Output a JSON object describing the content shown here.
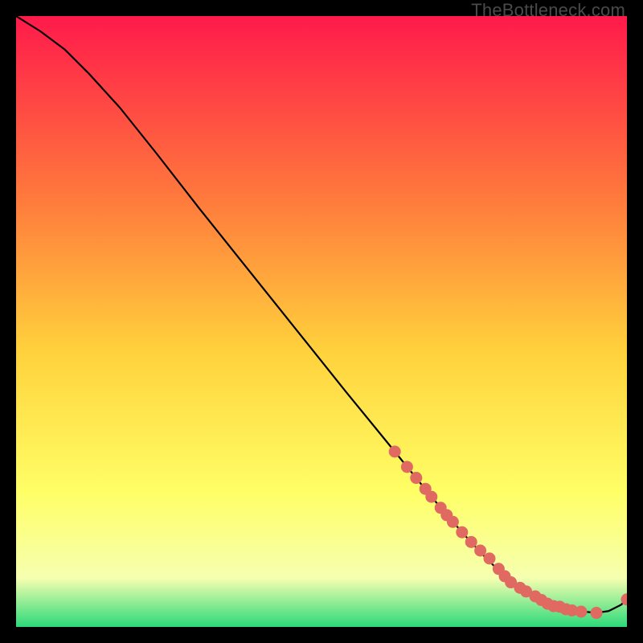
{
  "watermark": "TheBottleneck.com",
  "colors": {
    "top": "#ff1a4b",
    "mid1": "#ff7a3c",
    "mid2": "#ffd23c",
    "mid3": "#ffff66",
    "mid4": "#f6ffb0",
    "bottom": "#2cd97a",
    "curve": "#000000",
    "marker": "#e06a61"
  },
  "chart_data": {
    "type": "line",
    "title": "",
    "xlabel": "",
    "ylabel": "",
    "xlim": [
      0,
      100
    ],
    "ylim": [
      0,
      100
    ],
    "curve": {
      "x": [
        0,
        4,
        8,
        12,
        17,
        23,
        30,
        38,
        46,
        54,
        62,
        68,
        73,
        77,
        80,
        83,
        86,
        89,
        92,
        95,
        97,
        99,
        100
      ],
      "y": [
        100,
        97.5,
        94.5,
        90.5,
        85,
        77.5,
        68.5,
        58.5,
        48.5,
        38.5,
        28.7,
        21.3,
        15.5,
        11.2,
        8.3,
        6.0,
        4.4,
        3.3,
        2.6,
        2.3,
        2.6,
        3.6,
        4.5
      ]
    },
    "markers": {
      "x": [
        62,
        64,
        65.5,
        67,
        68,
        69.5,
        70.5,
        71.5,
        73,
        74.5,
        76,
        77.5,
        79,
        80,
        81,
        82.5,
        83.5,
        85,
        86,
        87,
        88,
        89,
        90,
        91,
        92.5,
        95,
        100
      ],
      "y": [
        28.7,
        26.2,
        24.4,
        22.6,
        21.3,
        19.5,
        18.3,
        17.2,
        15.5,
        13.9,
        12.5,
        11.2,
        9.5,
        8.3,
        7.3,
        6.4,
        5.8,
        5.0,
        4.4,
        3.8,
        3.4,
        3.3,
        2.9,
        2.7,
        2.5,
        2.3,
        4.5
      ]
    }
  }
}
